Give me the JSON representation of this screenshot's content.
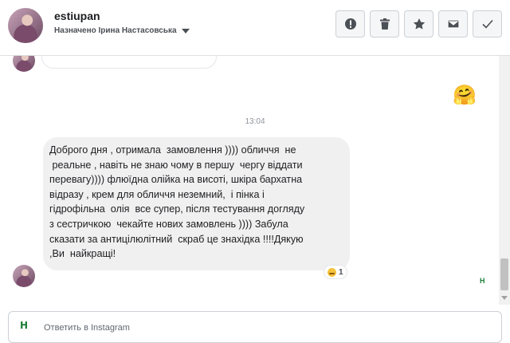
{
  "header": {
    "username": "estiupan",
    "assigned_text": "Назначено Ірина Настасовська",
    "actions": [
      "report-icon",
      "trash-icon",
      "star-icon",
      "envelope-icon",
      "check-icon"
    ]
  },
  "conversation": {
    "timestamp": "13:04",
    "message": "Доброго дня , отримала  замовлення )))) обличчя  не\n реальне , навіть не знаю чому в першу  чергу віддати\nперевагу)))) флюїдна олійка на висоті, шкіра бархатна\nвідразу , крем для обличчя неземний,  і пінка і\nгідрофільна  олія  все супер, після тестування догляду\nз сестричкою  чекайте нових замовлень )))) Забула\nсказати за антицілюлітний  скраб це знахідка !!!!Дякую\n,Ви  найкращі!",
    "reaction_count": "1",
    "seen_badge": "H",
    "sticker": "🤗"
  },
  "reply": {
    "placeholder": "Ответить в Instagram",
    "icon_label": "H"
  }
}
